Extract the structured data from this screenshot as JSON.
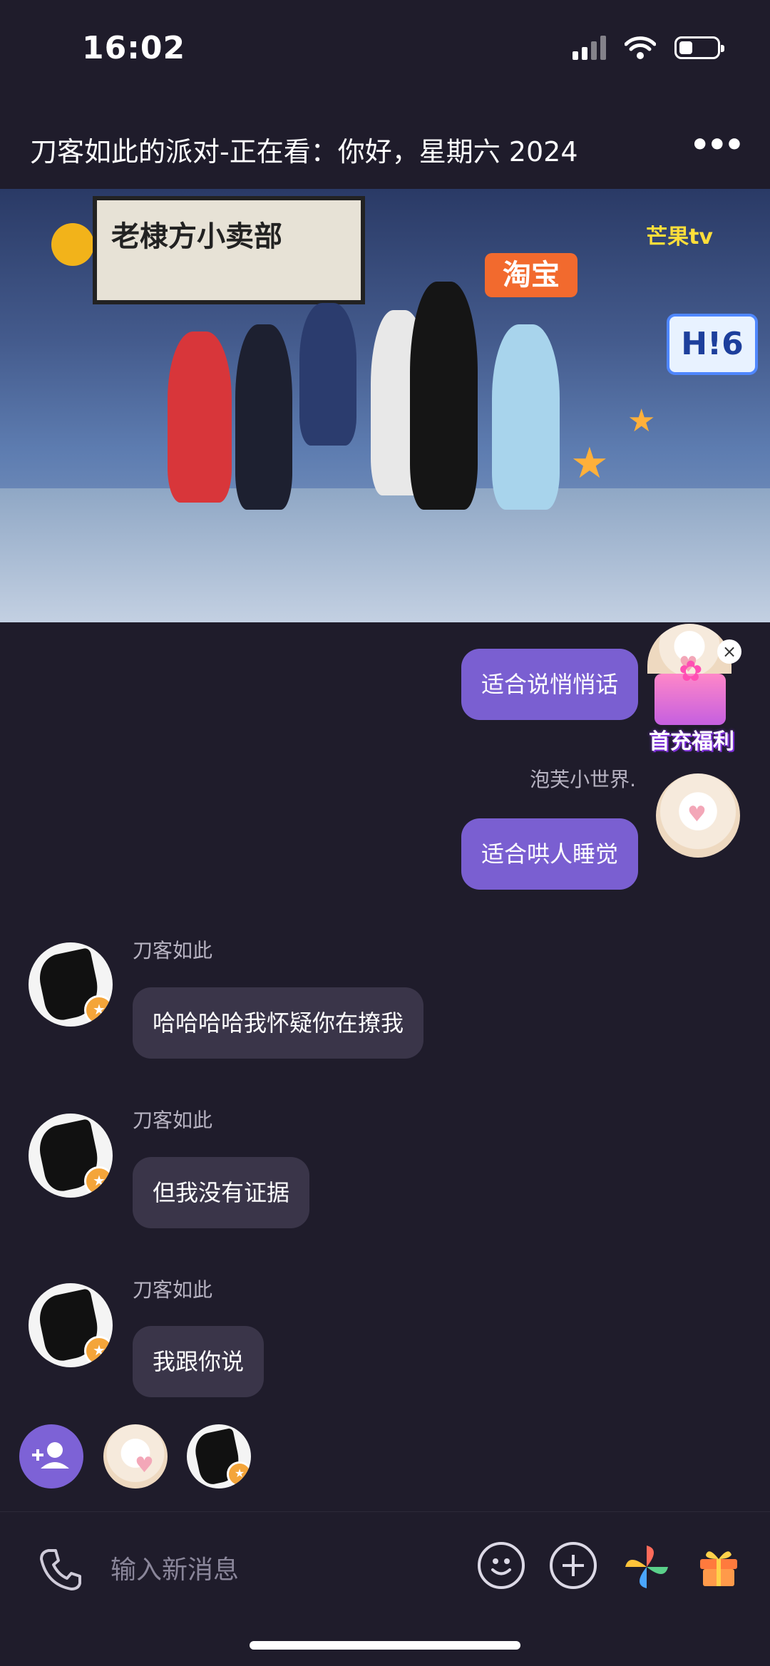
{
  "status": {
    "time": "16:02",
    "battery_level": 0.35
  },
  "header": {
    "title": "刀客如此的派对-正在看：你好，星期六 2024",
    "more_label": "•••"
  },
  "video": {
    "shop_sign": "老棣方小卖部",
    "ad_badge": "淘宝",
    "show_logo": "H!6",
    "channel_logo": "芒果tv"
  },
  "messages": [
    {
      "side": "out",
      "sender": "",
      "text": "适合说悄悄话"
    },
    {
      "side": "out",
      "sender": "泡芙小世界.",
      "text": "适合哄人睡觉"
    },
    {
      "side": "in",
      "sender": "刀客如此",
      "text": "哈哈哈哈我怀疑你在撩我"
    },
    {
      "side": "in",
      "sender": "刀客如此",
      "text": "但我没有证据"
    },
    {
      "side": "in",
      "sender": "刀客如此",
      "text": "我跟你说"
    }
  ],
  "promo": {
    "label": "首充福利",
    "close": "×"
  },
  "input": {
    "placeholder": "输入新消息"
  },
  "colors": {
    "accent": "#7a5fd1",
    "background": "#1f1c2b",
    "incoming_bubble": "#3a3549"
  }
}
